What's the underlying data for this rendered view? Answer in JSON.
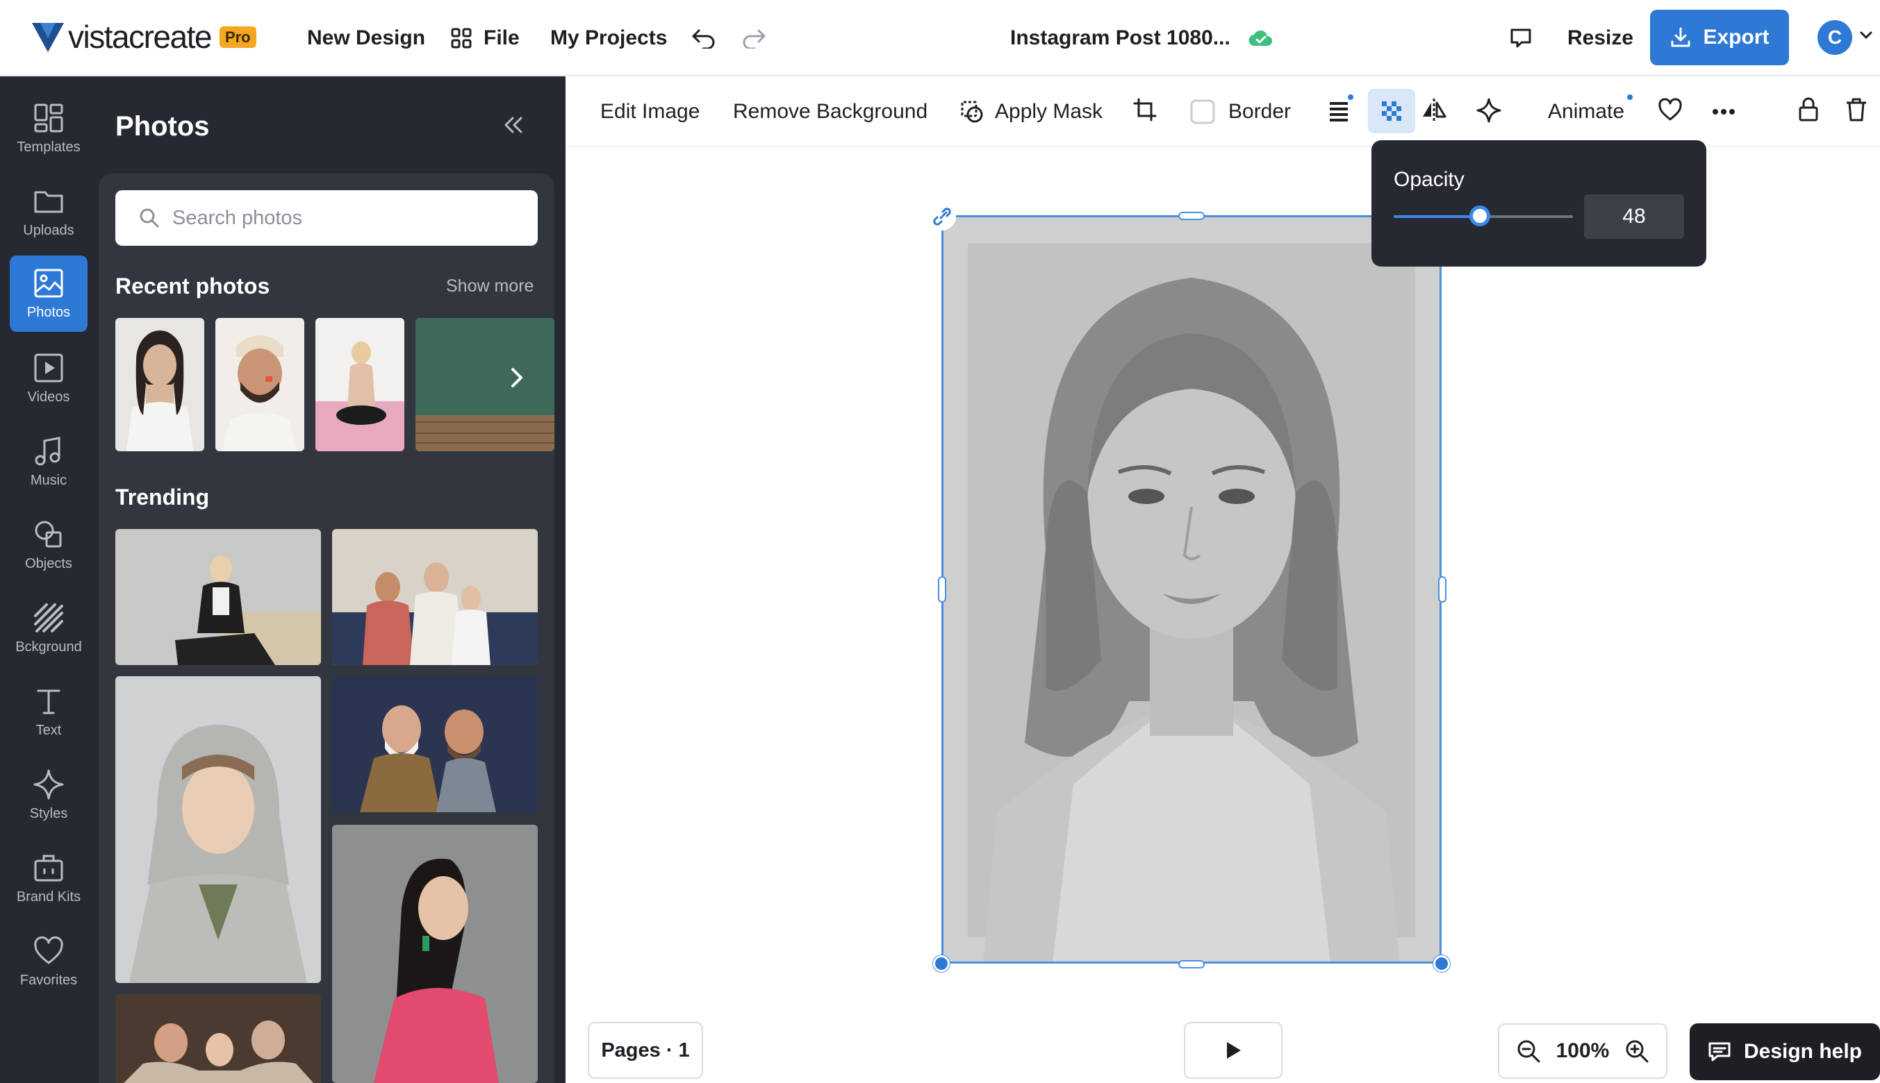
{
  "header": {
    "logo_text": "vistacreate",
    "pro_badge": "Pro",
    "new_design": "New Design",
    "file": "File",
    "my_projects": "My Projects",
    "document_title": "Instagram Post 1080...",
    "resize": "Resize",
    "export": "Export",
    "avatar_initial": "C"
  },
  "rail": {
    "items": [
      {
        "label": "Templates",
        "icon": "templates-icon"
      },
      {
        "label": "Uploads",
        "icon": "folder-icon"
      },
      {
        "label": "Photos",
        "icon": "photo-icon",
        "active": true
      },
      {
        "label": "Videos",
        "icon": "video-icon"
      },
      {
        "label": "Music",
        "icon": "music-icon"
      },
      {
        "label": "Objects",
        "icon": "shapes-icon"
      },
      {
        "label": "Bckground",
        "icon": "background-icon"
      },
      {
        "label": "Text",
        "icon": "text-icon"
      },
      {
        "label": "Styles",
        "icon": "sparkle-icon"
      },
      {
        "label": "Brand Kits",
        "icon": "briefcase-icon"
      },
      {
        "label": "Favorites",
        "icon": "heart-icon"
      }
    ]
  },
  "panel": {
    "title": "Photos",
    "search_placeholder": "Search photos",
    "recent_title": "Recent photos",
    "show_more": "Show more",
    "trending_title": "Trending"
  },
  "toolbar": {
    "edit_image": "Edit Image",
    "remove_background": "Remove Background",
    "apply_mask": "Apply Mask",
    "border": "Border",
    "animate": "Animate"
  },
  "opacity": {
    "label": "Opacity",
    "value": "48",
    "fraction": 0.48
  },
  "footer": {
    "pages": "Pages · 1",
    "zoom": "100%",
    "design_help": "Design help"
  },
  "colors": {
    "accent": "#2e79d6",
    "sidebar_bg": "#262932",
    "panel_bg": "#32363f",
    "pro_badge": "#f5a623",
    "saved_cloud": "#3dbf7f"
  }
}
